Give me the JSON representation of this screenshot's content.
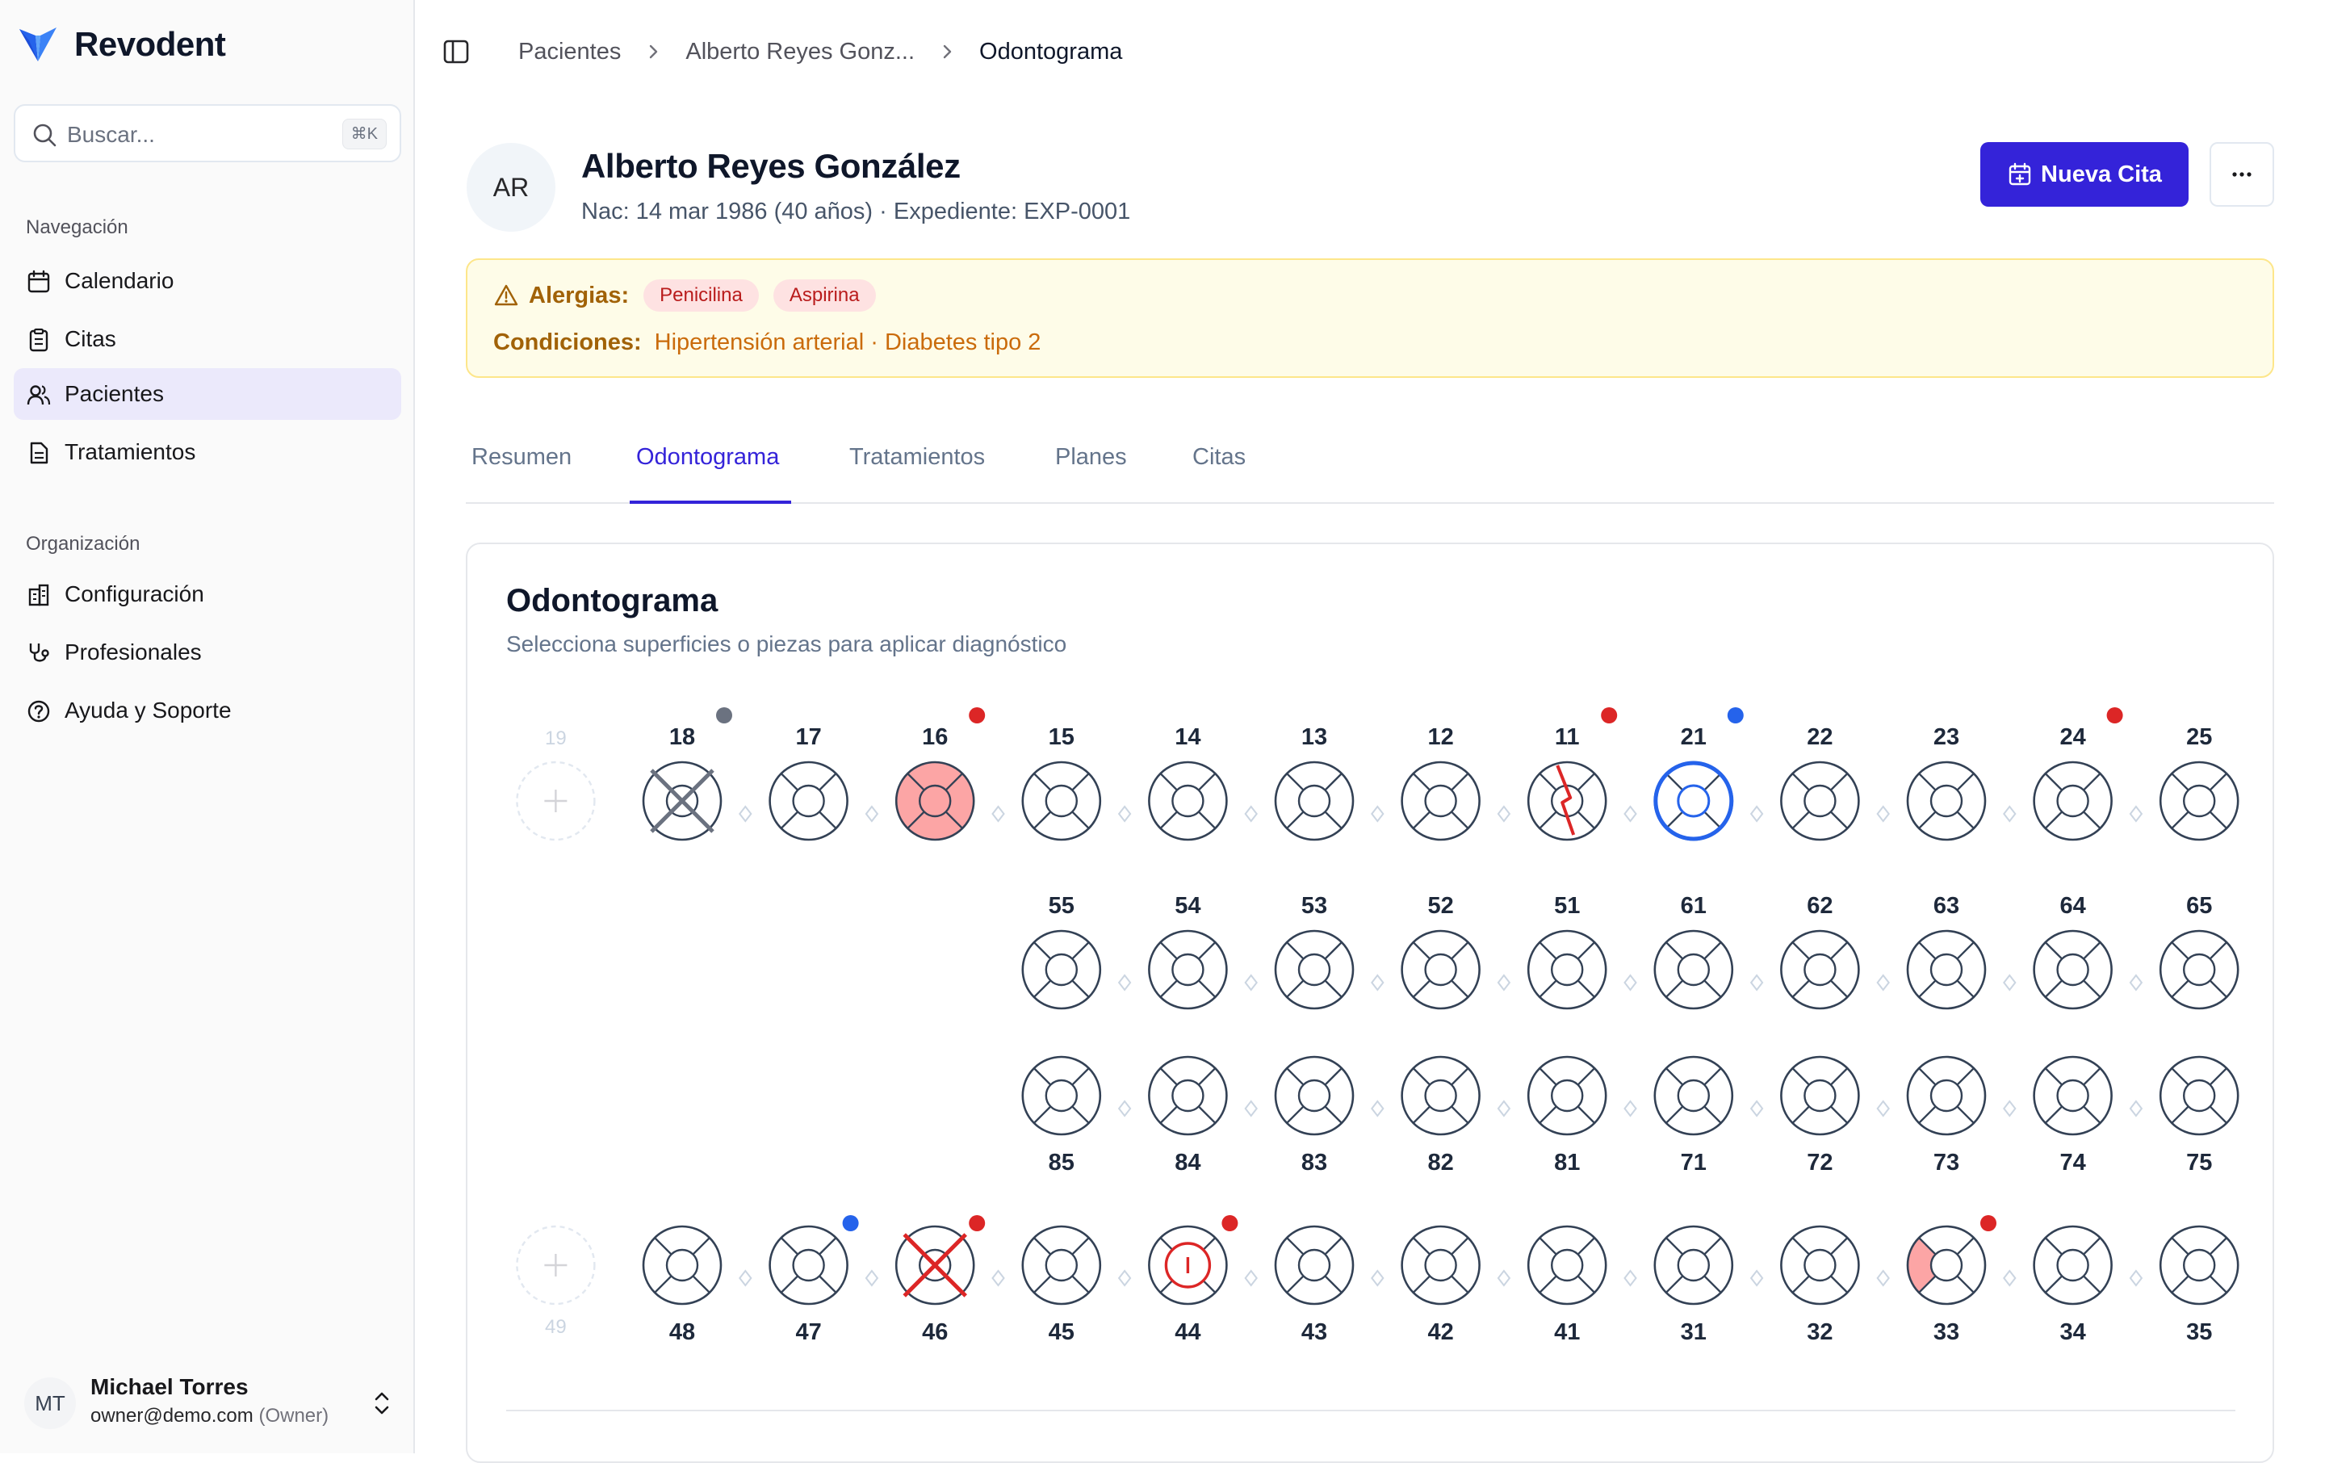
{
  "app": {
    "name": "Revodent"
  },
  "search": {
    "placeholder": "Buscar...",
    "shortcut": "⌘K"
  },
  "sidebar": {
    "nav_title": "Navegación",
    "nav_items": [
      {
        "label": "Calendario",
        "icon": "calendar-icon"
      },
      {
        "label": "Citas",
        "icon": "clipboard-icon"
      },
      {
        "label": "Pacientes",
        "icon": "users-icon",
        "active": true
      },
      {
        "label": "Tratamientos",
        "icon": "file-icon"
      }
    ],
    "org_title": "Organización",
    "org_items": [
      {
        "label": "Configuración",
        "icon": "building-icon"
      },
      {
        "label": "Profesionales",
        "icon": "stethoscope-icon"
      },
      {
        "label": "Ayuda y Soporte",
        "icon": "help-icon"
      }
    ]
  },
  "user": {
    "initials": "MT",
    "name": "Michael Torres",
    "email": "owner@demo.com",
    "role": "(Owner)"
  },
  "breadcrumb": [
    "Pacientes",
    "Alberto Reyes Gonz...",
    "Odontograma"
  ],
  "patient": {
    "initials": "AR",
    "name": "Alberto Reyes González",
    "meta": "Nac: 14 mar 1986 (40 años) · Expediente: EXP-0001"
  },
  "actions": {
    "new_appointment": "Nueva Cita"
  },
  "alerts": {
    "allergies_label": "Alergias:",
    "allergies": [
      "Penicilina",
      "Aspirina"
    ],
    "conditions_label": "Condiciones:",
    "conditions": "Hipertensión arterial · Diabetes tipo 2"
  },
  "tabs": [
    "Resumen",
    "Odontograma",
    "Tratamientos",
    "Planes",
    "Citas"
  ],
  "active_tab": "Odontograma",
  "odontogram": {
    "title": "Odontograma",
    "subtitle": "Selecciona superficies o piezas para aplicar diagnóstico",
    "colors": {
      "outline": "#334155",
      "red": "#dc2626",
      "blue": "#2563eb",
      "gray": "#6b7280",
      "fill_red": "#fca5a5"
    },
    "rows": [
      {
        "label_pos": "above",
        "ghost": "19",
        "teeth": [
          {
            "n": "18",
            "state": "missing-gray",
            "dot": "gray"
          },
          {
            "n": "17"
          },
          {
            "n": "16",
            "state": "red-full",
            "dot": "red"
          },
          {
            "n": "15"
          },
          {
            "n": "14"
          },
          {
            "n": "13"
          },
          {
            "n": "12"
          },
          {
            "n": "11",
            "state": "fracture",
            "dot": "red"
          },
          {
            "n": "21",
            "state": "blue-ring",
            "dot": "blue"
          },
          {
            "n": "22"
          },
          {
            "n": "23"
          },
          {
            "n": "24",
            "dot": "red"
          },
          {
            "n": "25"
          }
        ]
      },
      {
        "label_pos": "above",
        "offset": 3,
        "teeth": [
          {
            "n": "55"
          },
          {
            "n": "54"
          },
          {
            "n": "53"
          },
          {
            "n": "52"
          },
          {
            "n": "51"
          },
          {
            "n": "61"
          },
          {
            "n": "62"
          },
          {
            "n": "63"
          },
          {
            "n": "64"
          },
          {
            "n": "65"
          }
        ]
      },
      {
        "label_pos": "below",
        "offset": 3,
        "teeth": [
          {
            "n": "85"
          },
          {
            "n": "84"
          },
          {
            "n": "83"
          },
          {
            "n": "82"
          },
          {
            "n": "81"
          },
          {
            "n": "71"
          },
          {
            "n": "72"
          },
          {
            "n": "73"
          },
          {
            "n": "74"
          },
          {
            "n": "75"
          }
        ]
      },
      {
        "label_pos": "below",
        "ghost": "49",
        "teeth": [
          {
            "n": "48"
          },
          {
            "n": "47",
            "dot": "blue"
          },
          {
            "n": "46",
            "state": "extraction",
            "dot": "red"
          },
          {
            "n": "45"
          },
          {
            "n": "44",
            "state": "implant",
            "dot": "red"
          },
          {
            "n": "43"
          },
          {
            "n": "42"
          },
          {
            "n": "41"
          },
          {
            "n": "31"
          },
          {
            "n": "32"
          },
          {
            "n": "33",
            "state": "red-left",
            "dot": "red"
          },
          {
            "n": "34"
          },
          {
            "n": "35"
          }
        ]
      }
    ]
  }
}
